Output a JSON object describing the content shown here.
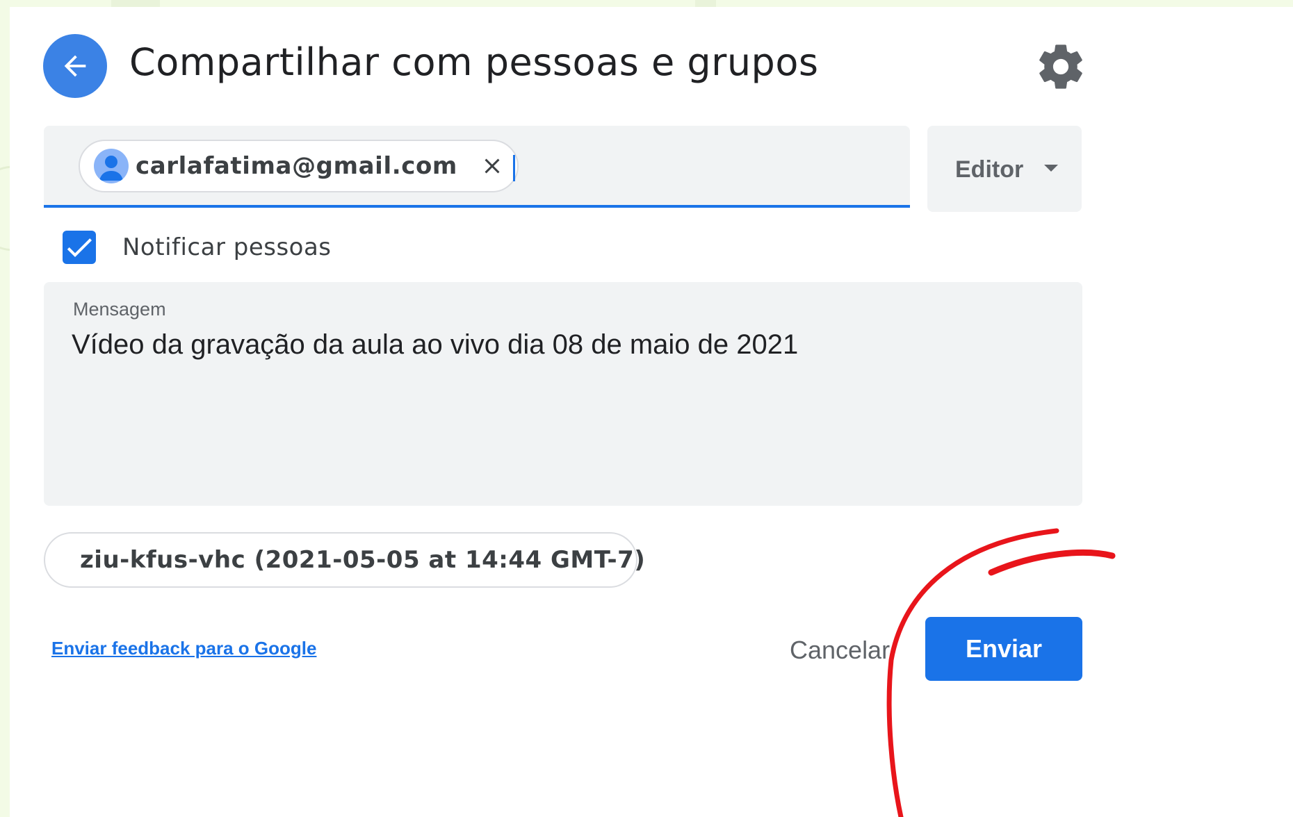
{
  "dialog": {
    "title": "Compartilhar com pessoas e grupos",
    "icons": {
      "back": "arrow-left-icon",
      "settings": "gear-icon"
    }
  },
  "recipients": {
    "chips": [
      {
        "email": "carlafatima@gmail.com",
        "avatar": "person-avatar-icon",
        "remove_icon": "close-icon"
      }
    ]
  },
  "role": {
    "selected": "Editor",
    "icon": "dropdown-arrow-icon"
  },
  "notify": {
    "label": "Notificar pessoas",
    "checked": true
  },
  "message": {
    "label": "Mensagem",
    "text": "Vídeo da gravação da aula ao vivo dia 08 de maio de 2021"
  },
  "attachment": {
    "name": "ziu-kfus-vhc (2021-05-05 at 14:44 GMT-7)",
    "icon": "video-file-icon"
  },
  "footer": {
    "feedback_link": "Enviar feedback para o Google",
    "cancel_label": "Cancelar",
    "send_label": "Enviar"
  },
  "colors": {
    "accent": "#1a73e8",
    "back_button": "#3b82e5",
    "annotation": "#e8151b",
    "file_icon": "#d93025"
  }
}
